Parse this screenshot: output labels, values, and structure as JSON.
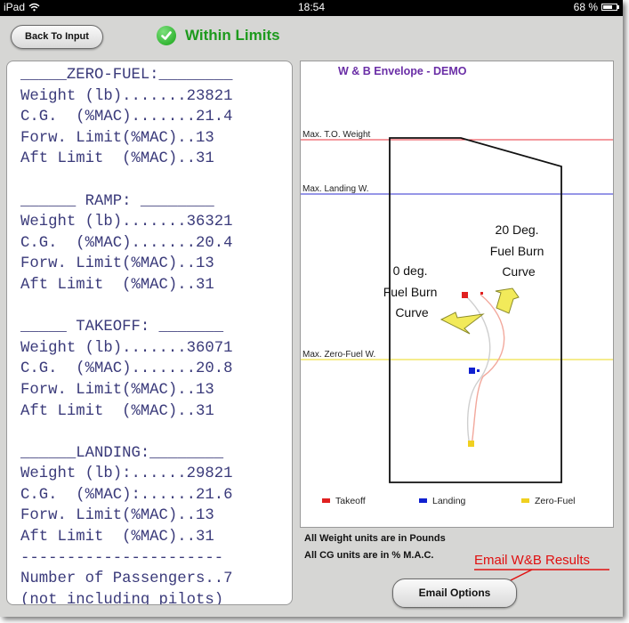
{
  "status_bar": {
    "device": "iPad",
    "time": "18:54",
    "battery": "68 %",
    "battery_level": 0.68
  },
  "header": {
    "back_button": "Back To Input",
    "status_text": "Within Limits",
    "status_color": "#1d9a1d"
  },
  "report": {
    "lines": [
      "_____ZERO-FUEL:________",
      "Weight (lb).......23821",
      "C.G.  (%MAC).......21.4",
      "Forw. Limit(%MAC)..13",
      "Aft Limit  (%MAC)..31",
      "",
      "______ RAMP: ________",
      "Weight (lb).......36321",
      "C.G.  (%MAC).......20.4",
      "Forw. Limit(%MAC)..13",
      "Aft Limit  (%MAC)..31",
      "",
      "_____ TAKEOFF: _______",
      "Weight (lb).......36071",
      "C.G.  (%MAC).......20.8",
      "Forw. Limit(%MAC)..13",
      "Aft Limit  (%MAC)..31",
      "",
      "______LANDING:________",
      "Weight (lb):......29821",
      "C.G.  (%MAC):......21.6",
      "Forw. Limit(%MAC)..13",
      "Aft Limit  (%MAC)..31",
      "----------------------",
      "Number of Passengers..7",
      "(not including pilots)"
    ]
  },
  "chart": {
    "title": "W & B Envelope - DEMO",
    "limit_lines": {
      "takeoff": {
        "label": "Max. T.O. Weight",
        "color": "#e8343c"
      },
      "landing": {
        "label": "Max. Landing W.",
        "color": "#2c2ccf"
      },
      "zero_fuel": {
        "label": "Max. Zero-Fuel W.",
        "color": "#efe04a"
      }
    },
    "annotation_0deg": [
      "0 deg.",
      "Fuel Burn",
      "Curve"
    ],
    "annotation_20deg": [
      "20 Deg.",
      "Fuel Burn",
      "Curve"
    ],
    "legend": [
      {
        "label": "Takeoff",
        "color": "#e02020"
      },
      {
        "label": "Landing",
        "color": "#1020d0"
      },
      {
        "label": "Zero-Fuel",
        "color": "#f0d020"
      }
    ]
  },
  "notes": {
    "weight_units": "All Weight units are in Pounds",
    "cg_units": "All CG units are in % M.A.C."
  },
  "email": {
    "annotation": "Email W&B Results",
    "button": "Email Options"
  }
}
